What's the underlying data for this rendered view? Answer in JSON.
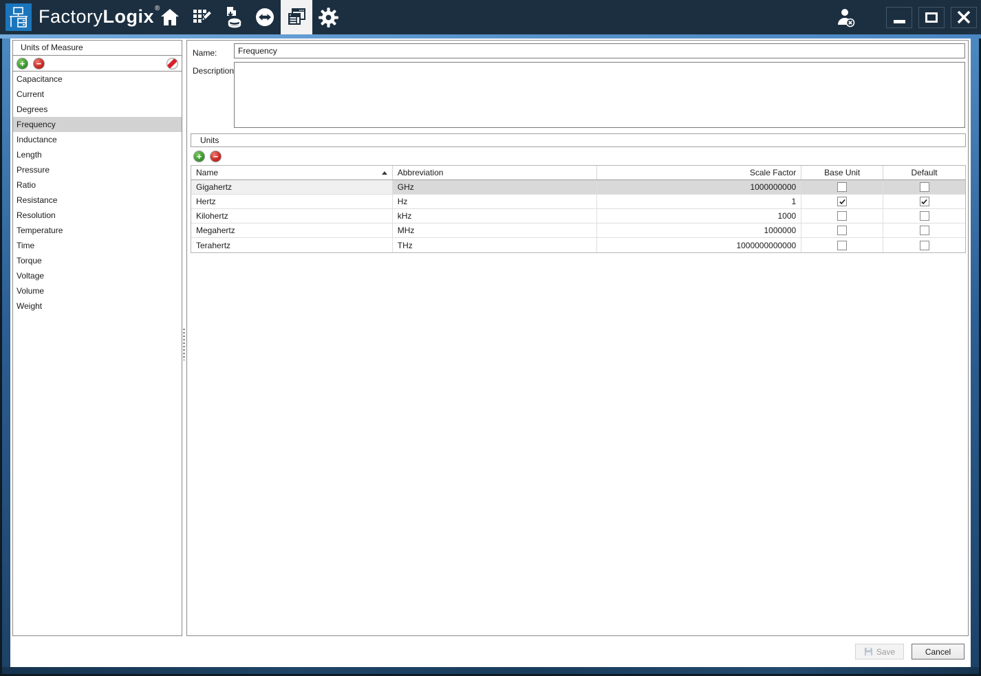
{
  "titlebar": {
    "brand_light": "Factory",
    "brand_bold": "Logix",
    "registered_mark": "®",
    "nav_icons": [
      "home-icon",
      "production-edit-icon",
      "data-import-icon",
      "sync-icon",
      "documents-icon",
      "settings-gear-icon"
    ],
    "active_nav_icon": "documents-icon",
    "window_controls": [
      "logoff-user-icon",
      "minimize-button",
      "maximize-button",
      "close-button"
    ]
  },
  "sidebar": {
    "title": "Units of Measure",
    "toolbar_icons": [
      "add-icon",
      "remove-icon",
      "block-edit-icon"
    ],
    "items": [
      "Capacitance",
      "Current",
      "Degrees",
      "Frequency",
      "Inductance",
      "Length",
      "Pressure",
      "Ratio",
      "Resistance",
      "Resolution",
      "Temperature",
      "Time",
      "Torque",
      "Voltage",
      "Volume",
      "Weight"
    ],
    "selected_item": "Frequency"
  },
  "form": {
    "name_label": "Name:",
    "name_value": "Frequency",
    "description_label": "Description:",
    "description_value": ""
  },
  "units_panel": {
    "title": "Units",
    "toolbar_icons": [
      "add-icon",
      "remove-icon"
    ],
    "columns": [
      "Name",
      "Abbreviation",
      "Scale Factor",
      "Base Unit",
      "Default"
    ],
    "sort_column": "Name",
    "sort_direction": "ascending",
    "rows": [
      {
        "name": "Gigahertz",
        "abbreviation": "GHz",
        "scale_factor": "1000000000",
        "base_unit": false,
        "default": false,
        "selected": true
      },
      {
        "name": "Hertz",
        "abbreviation": "Hz",
        "scale_factor": "1",
        "base_unit": true,
        "default": true,
        "selected": false
      },
      {
        "name": "Kilohertz",
        "abbreviation": "kHz",
        "scale_factor": "1000",
        "base_unit": false,
        "default": false,
        "selected": false
      },
      {
        "name": "Megahertz",
        "abbreviation": "MHz",
        "scale_factor": "1000000",
        "base_unit": false,
        "default": false,
        "selected": false
      },
      {
        "name": "Terahertz",
        "abbreviation": "THz",
        "scale_factor": "1000000000000",
        "base_unit": false,
        "default": false,
        "selected": false
      }
    ]
  },
  "footer": {
    "save_label": "Save",
    "cancel_label": "Cancel"
  },
  "colors": {
    "titlebar": "#1c2f40",
    "logo_blue": "#1b75bc",
    "accent_strip": "#5a95cd",
    "selected_row": "#d9d9d9",
    "selected_list_item": "#d2d2d2",
    "add_green": "#3f9c35",
    "remove_red": "#cc2c27"
  }
}
